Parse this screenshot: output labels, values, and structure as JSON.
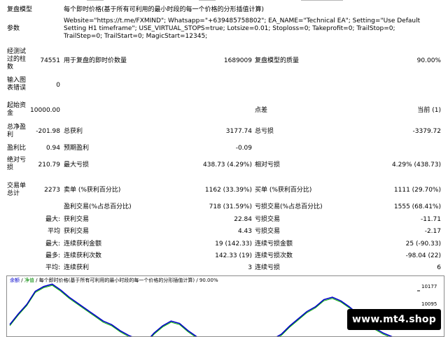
{
  "report": {
    "model_label": "复盘模型",
    "model_value": "每个即时价格(基于所有可利用的最小时段的每一个价格的分形插值计算)",
    "params_label": "参数",
    "params_value": "Website=\"https://t.me/FXMIND\"; Whatsapp=\"+639485758802\"; EA_NAME=\"Technical EA\"; Setting=\"Use Default Setting H1 timeframe\"; USE_VIRTUAL_STOPS=true; Lotsize=0.01; Stoploss=0; Takeprofit=0; TrailStop=0; TrailStep=0; TrailStart=0; MagicStart=12345;",
    "bars_label": "经测试过的柱数",
    "bars_value": "74551",
    "ticks_label": "用于复盘的即时价数量",
    "ticks_value": "1689009",
    "quality_label": "复盘模型的质量",
    "quality_value": "90.00%",
    "errors_label": "输入图表错误",
    "errors_value": "0",
    "deposit_label": "起始资金",
    "deposit_value": "10000.00",
    "spread_label": "点差",
    "spread_value": "当前 (1)",
    "net_label": "总净盈利",
    "net_value": "-201.98",
    "gross_profit_label": "总获利",
    "gross_profit_value": "3177.74",
    "gross_loss_label": "总亏损",
    "gross_loss_value": "-3379.72",
    "pf_label": "盈利比",
    "pf_value": "0.94",
    "expected_label": "预期盈利",
    "expected_value": "-0.09",
    "abs_dd_label": "绝对亏损",
    "abs_dd_value": "210.79",
    "max_dd_label": "最大亏损",
    "max_dd_value": "438.73 (4.29%)",
    "rel_dd_label": "相对亏损",
    "rel_dd_value": "4.29% (438.73)",
    "trades_label": "交易单总计",
    "trades_value": "2273",
    "short_label": "卖单 (%获利百分比)",
    "short_value": "1162 (33.39%)",
    "long_label": "买单 (%获利百分比)",
    "long_value": "1111 (29.70%)",
    "profit_trades_label": "盈利交易(%占总百分比)",
    "profit_trades_value": "718 (31.59%)",
    "loss_trades_label": "亏损交易(%占总百分比)",
    "loss_trades_value": "1555 (68.41%)",
    "largest_prefix": "最大:",
    "largest_profit_label": "获利交易",
    "largest_profit_value": "22.84",
    "largest_loss_label": "亏损交易",
    "largest_loss_value": "-11.71",
    "average_prefix": "平均",
    "average_profit_label": "获利交易",
    "average_profit_value": "4.43",
    "average_loss_label": "亏损交易",
    "average_loss_value": "-2.17",
    "max_consec_prefix": "最大:",
    "max_consec_wins_label": "连续获利金额",
    "max_consec_wins_value": "19 (142.33)",
    "max_consec_losses_label": "连续亏损金额",
    "max_consec_losses_value": "25 (-90.33)",
    "most_prefix": "最多:",
    "most_profit_label": "连续获利次数",
    "most_profit_value": "142.33 (19)",
    "most_loss_label": "连续亏损次数",
    "most_loss_value": "-98.04 (22)",
    "avg_consec_prefix": "平均:",
    "avg_consec_wins_label": "连续获利",
    "avg_consec_wins_value": "3",
    "avg_consec_losses_label": "连续亏损",
    "avg_consec_losses_value": "6"
  },
  "chart": {
    "caption_balance": "余额",
    "caption_sep1": "/",
    "caption_equity": "净值",
    "caption_rest": "/ 每个即时价格(基于所有可利用的最小时段的每一个价格的分形插值计算) / 90.00%",
    "y_labels": [
      "10177",
      "10095"
    ],
    "colors": {
      "balance": "#0000c8",
      "equity": "#00aa00",
      "caption_blue": "#0000cc",
      "caption_green": "#008800"
    }
  },
  "chart_data": {
    "type": "line",
    "title": "",
    "y_ticks": [
      10177,
      10095
    ],
    "ylim": [
      9945,
      10215
    ],
    "series": [
      {
        "name": "余额",
        "values": [
          10035,
          10080,
          10120,
          10175,
          10195,
          10205,
          10180,
          10150,
          10125,
          10100,
          10075,
          10050,
          10035,
          10010,
          9990,
          9975,
          9960,
          10000,
          10030,
          10050,
          10040,
          10010,
          9985,
          9965,
          9950,
          9955,
          9950,
          9948,
          9950,
          9952,
          9960,
          9975,
          9995,
          10030,
          10060,
          10090,
          10110,
          10140,
          10150,
          10135,
          10110,
          10080,
          10050,
          10020,
          10000,
          9985,
          9965,
          9955,
          9950
        ]
      },
      {
        "name": "净值",
        "values": [
          10030,
          10075,
          10115,
          10170,
          10190,
          10200,
          10175,
          10145,
          10120,
          10095,
          10070,
          10045,
          10030,
          10005,
          9985,
          9970,
          9955,
          9995,
          10025,
          10045,
          10035,
          10005,
          9980,
          9960,
          9945,
          9950,
          9946,
          9945,
          9946,
          9948,
          9955,
          9970,
          9990,
          10025,
          10055,
          10085,
          10105,
          10135,
          10145,
          10130,
          10105,
          10075,
          10045,
          10015,
          9995,
          9980,
          9960,
          9950,
          9946
        ]
      }
    ]
  }
}
